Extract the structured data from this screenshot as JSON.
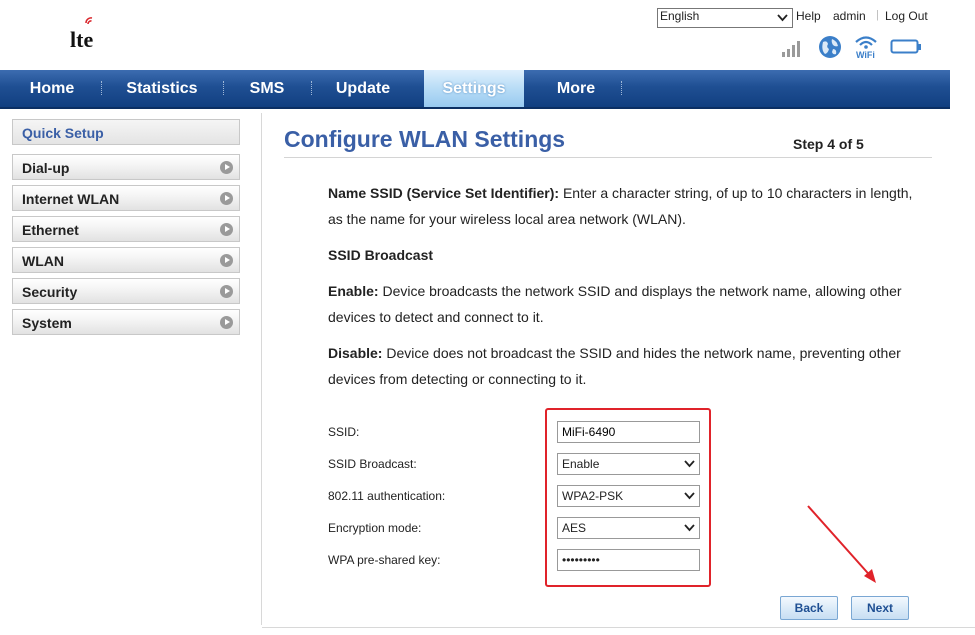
{
  "header": {
    "language": "English",
    "help_label": "Help",
    "user": "admin",
    "logout_label": "Log Out",
    "logo_text": "lte",
    "wifi_icon_text": "WiFi"
  },
  "nav": {
    "tabs": [
      {
        "label": "Home"
      },
      {
        "label": "Statistics"
      },
      {
        "label": "SMS"
      },
      {
        "label": "Update"
      },
      {
        "label": "Settings",
        "active": true
      },
      {
        "label": "More"
      }
    ]
  },
  "sidebar": {
    "items": [
      {
        "label": "Quick Setup"
      },
      {
        "label": "Dial-up"
      },
      {
        "label": "Internet WLAN"
      },
      {
        "label": "Ethernet"
      },
      {
        "label": "WLAN"
      },
      {
        "label": "Security"
      },
      {
        "label": "System"
      }
    ]
  },
  "main": {
    "title": "Configure WLAN Settings",
    "step": "Step 4 of 5",
    "ssid_help_bold": "Name SSID (Service Set Identifier):",
    "ssid_help_text": " Enter a character string, of up to 10 characters in length, as the name for your wireless local area network (WLAN).",
    "broadcast_heading": "SSID Broadcast",
    "enable_bold": "Enable:",
    "enable_text": " Device broadcasts the network SSID and displays the network name, allowing other devices to detect and connect to it.",
    "disable_bold": "Disable:",
    "disable_text": " Device does not broadcast the SSID and hides the network name, preventing other devices from detecting or connecting to it."
  },
  "form": {
    "ssid_label": "SSID:",
    "ssid_value": "MiFi-6490",
    "broadcast_label": "SSID Broadcast:",
    "broadcast_value": "Enable",
    "auth_label": "802.11 authentication:",
    "auth_value": "WPA2-PSK",
    "encryption_label": "Encryption mode:",
    "encryption_value": "AES",
    "psk_label": "WPA pre-shared key:",
    "psk_value": "•••••••••"
  },
  "buttons": {
    "back": "Back",
    "next": "Next"
  },
  "colors": {
    "accent": "#3a5fa6",
    "nav_bg": "#1f4f93",
    "highlight": "#e0232a"
  }
}
